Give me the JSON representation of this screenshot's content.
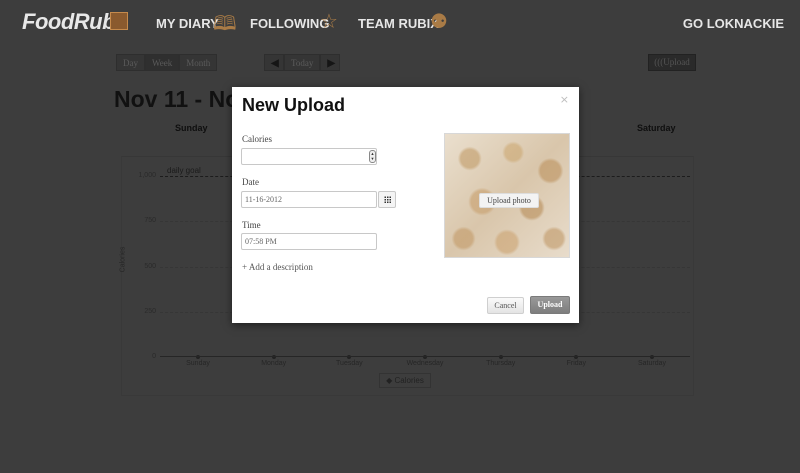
{
  "nav": {
    "logo": "FoodRubi",
    "my_diary": "MY DIARY",
    "following": "FOLLOWING",
    "team_rubix": "TEAM RUBIX",
    "user": "GO LOKNACKIE",
    "icons": [
      "book-icon",
      "star-icon",
      "team-icon"
    ]
  },
  "toolbar": {
    "views": [
      "Day",
      "Week",
      "Month"
    ],
    "active_view": "Week",
    "today": "Today",
    "upload": "(((Upload"
  },
  "page_title": "Nov 11 - No",
  "day_headers": [
    "Sunday",
    "Saturday"
  ],
  "chart_data": {
    "type": "line",
    "ylabel": "Calories",
    "y_ticks": [
      "1,000",
      "750",
      "500",
      "250",
      "0"
    ],
    "goal_label": "daily goal",
    "x": [
      "Sunday",
      "Monday",
      "Tuesday",
      "Wednesday",
      "Thursday",
      "Friday",
      "Saturday"
    ],
    "series": [
      {
        "name": "Calories",
        "values": [
          0,
          0,
          0,
          0,
          0,
          0,
          0
        ]
      }
    ],
    "ylim": [
      0,
      1000
    ],
    "legend": "Calories"
  },
  "modal": {
    "title": "New Upload",
    "close": "×",
    "calories_label": "Calories",
    "calories_value": "",
    "date_label": "Date",
    "date_value": "11-16-2012",
    "time_label": "Time",
    "time_value": "07:58 PM",
    "add_description": "+ Add a description",
    "upload_photo": "Upload photo",
    "cancel": "Cancel",
    "upload": "Upload"
  }
}
